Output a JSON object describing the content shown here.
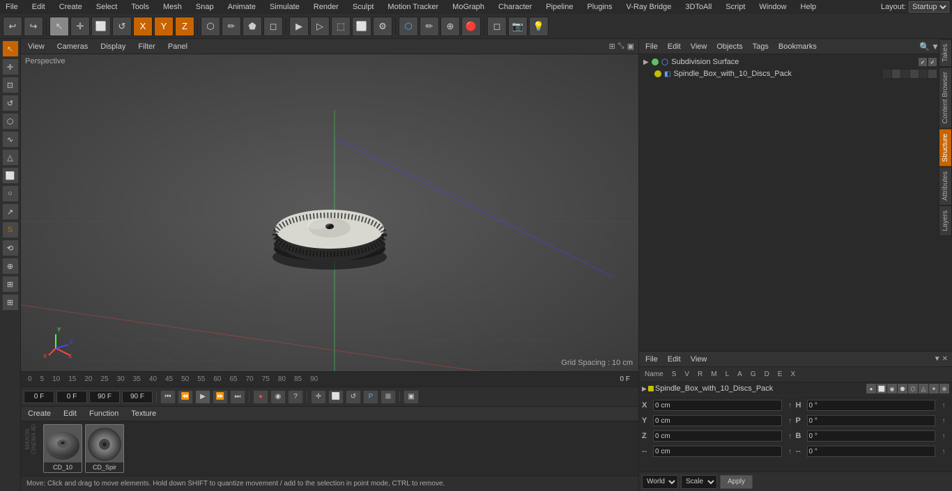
{
  "app": {
    "title": "Cinema 4D",
    "layout": "Startup"
  },
  "menu": {
    "items": [
      "File",
      "Edit",
      "Create",
      "Select",
      "Tools",
      "Mesh",
      "Snap",
      "Animate",
      "Simulate",
      "Render",
      "Sculpt",
      "Motion Tracker",
      "MoGraph",
      "Character",
      "Pipeline",
      "Plugins",
      "V-Ray Bridge",
      "3DToAll",
      "Script",
      "Window",
      "Help"
    ]
  },
  "toolbar": {
    "undo": "↩",
    "mode_buttons": [
      "Select",
      "Move",
      "Scale",
      "Rotate"
    ],
    "transform_x": "X",
    "transform_y": "Y",
    "transform_z": "Z"
  },
  "viewport": {
    "perspective_label": "Perspective",
    "header_items": [
      "View",
      "Cameras",
      "Display",
      "Filter",
      "Panel"
    ],
    "grid_spacing": "Grid Spacing : 10 cm",
    "header_menus": [
      "View",
      "Cameras",
      "Display",
      "Filter",
      "Panel"
    ]
  },
  "object_manager": {
    "header_menus": [
      "File",
      "Edit",
      "View",
      "Objects",
      "Tags",
      "Bookmarks"
    ],
    "objects": [
      {
        "name": "Subdivision Surface",
        "dot_color": "green",
        "icon": "⬡",
        "controls": [
          "✓",
          "✓"
        ],
        "color": "#c86400",
        "indented": false
      },
      {
        "name": "Spindle_Box_with_10_Discs_Pack",
        "dot_color": "yellow",
        "icon": "⬡",
        "controls": [],
        "color": "#c8c800",
        "indented": true
      }
    ]
  },
  "attribute_manager": {
    "header_menus": [
      "File",
      "Edit",
      "View"
    ],
    "columns": [
      "Name",
      "S",
      "V",
      "R",
      "M",
      "L",
      "A",
      "G",
      "D",
      "E",
      "X"
    ],
    "row": {
      "name": "Spindle_Box_with_10_Discs_Pack",
      "color": "#c8c800"
    }
  },
  "coordinates": {
    "position": {
      "x": "0 cm",
      "y": "0 cm",
      "z": "0 cm"
    },
    "hpb": {
      "h": "0 °",
      "p": "0 °",
      "b": "0 °"
    },
    "size": {
      "x": "0 cm",
      "y": "0 cm",
      "z": "0 cm"
    }
  },
  "bottom_controls": {
    "world_label": "World",
    "scale_label": "Scale",
    "apply_label": "Apply"
  },
  "material": {
    "header_menus": [
      "Create",
      "Edit",
      "Function",
      "Texture"
    ],
    "items": [
      {
        "name": "CD_10",
        "type": "disc"
      },
      {
        "name": "CD_Spir",
        "type": "spiral"
      }
    ]
  },
  "timeline": {
    "markers": [
      "0",
      "5",
      "10",
      "15",
      "20",
      "25",
      "30",
      "35",
      "40",
      "45",
      "50",
      "55",
      "60",
      "65",
      "70",
      "75",
      "80",
      "85",
      "90"
    ],
    "current_frame": "0 F",
    "end_frame": "90 F"
  },
  "playback": {
    "start_field": "0 F",
    "current_field": "0 F",
    "end_field": "90 F",
    "end2_field": "90 F"
  },
  "status": {
    "text": "Move: Click and drag to move elements. Hold down SHIFT to quantize movement / add to the selection in point mode, CTRL to remove."
  },
  "right_tabs": [
    "Takes",
    "Content Browser",
    "Structure",
    "Attributes",
    "Layers"
  ],
  "left_tools": [
    "▶",
    "✛",
    "⬜",
    "↺",
    "⊕",
    "⬡",
    "▲",
    "◆",
    "⊙",
    "↗",
    "S",
    "⟲",
    "⊕"
  ]
}
